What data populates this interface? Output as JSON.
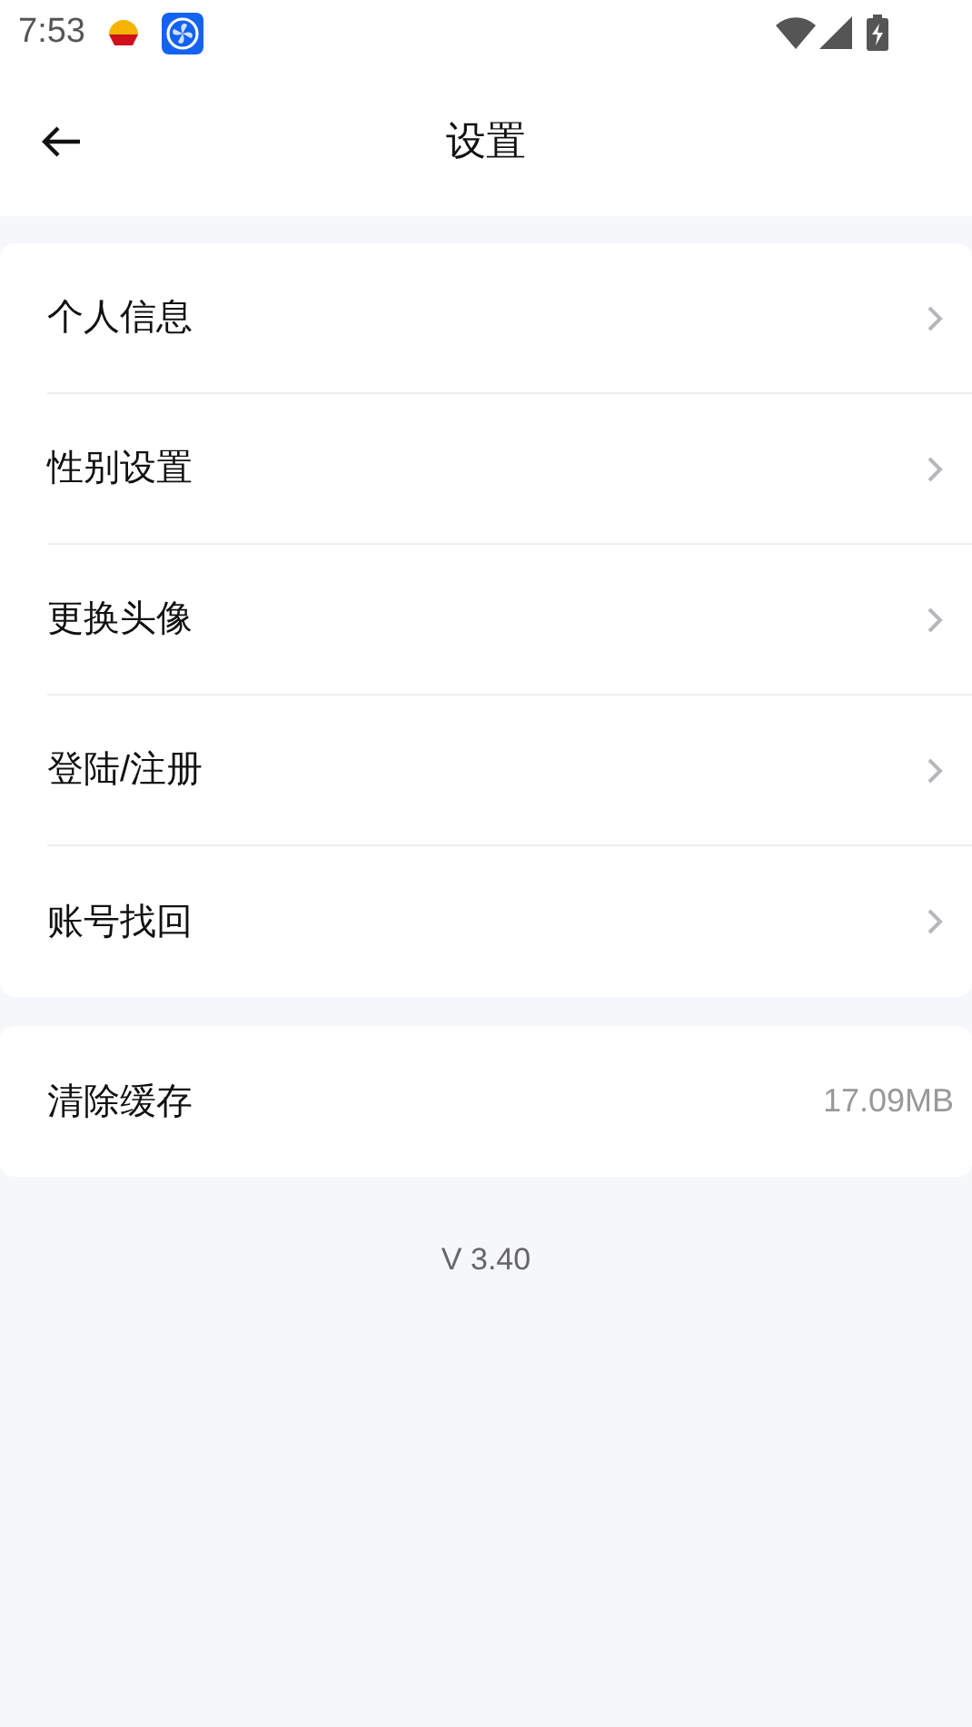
{
  "status_bar": {
    "time": "7:53"
  },
  "header": {
    "title": "设置"
  },
  "menu_items": [
    {
      "label": "个人信息"
    },
    {
      "label": "性别设置"
    },
    {
      "label": "更换头像"
    },
    {
      "label": "登陆/注册"
    },
    {
      "label": "账号找回"
    }
  ],
  "cache": {
    "label": "清除缓存",
    "value": "17.09MB"
  },
  "version": "V 3.40"
}
